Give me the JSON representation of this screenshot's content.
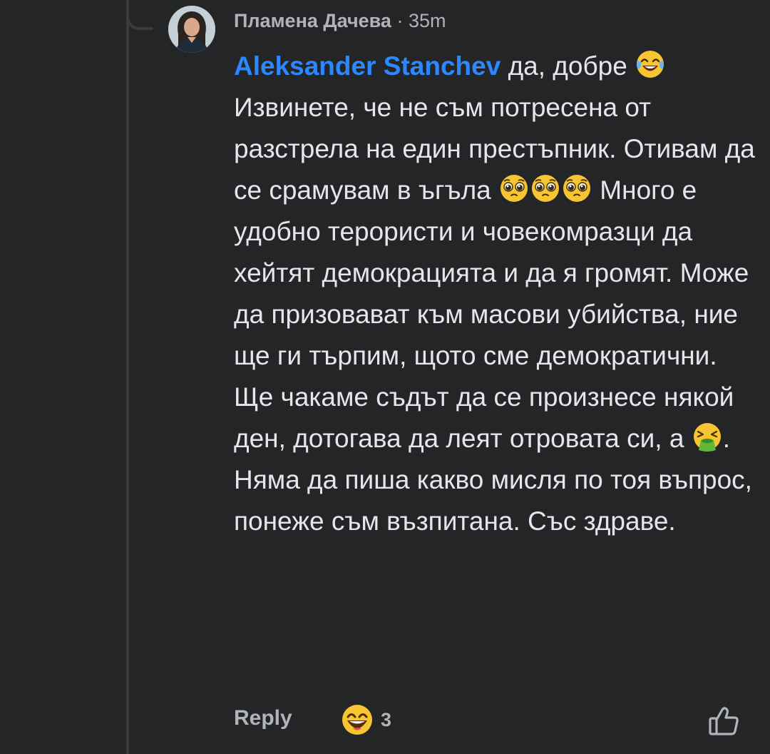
{
  "comment": {
    "author": "Пламена Дачева",
    "separator": "·",
    "timestamp": "35m",
    "mention": "Aleksander Stanchev",
    "text_1": " да, добре ",
    "text_2": " Извинете, че не съм потресена от разстрела на един престъпник. Отивам да се срамувам в ъгъла ",
    "text_3": " Много е удобно терористи и човекомразци да хейтят демокрацията и да я громят. Може да призовават към масови убийства, ние ще ги търпим, щото сме демократични. Ще чакаме съдът да се произнесе някой ден, дотогава да леят отровата си, а ",
    "text_4": ". Няма да пиша какво мисля по тоя въпрос, понеже съм възпитана. Със здраве."
  },
  "emojis": {
    "laugh": "face-with-tears-of-joy-icon",
    "pleading": "pleading-face-icon",
    "vomit": "face-vomiting-icon"
  },
  "footer": {
    "reply_label": "Reply",
    "reaction_count": "3",
    "reaction_icon": "grinning-face-icon",
    "like_icon": "thumbs-up-outline-icon"
  },
  "colors": {
    "background": "#242526",
    "text": "#e4e6eb",
    "secondary": "#b0b3b8",
    "mention": "#2d88ff"
  }
}
